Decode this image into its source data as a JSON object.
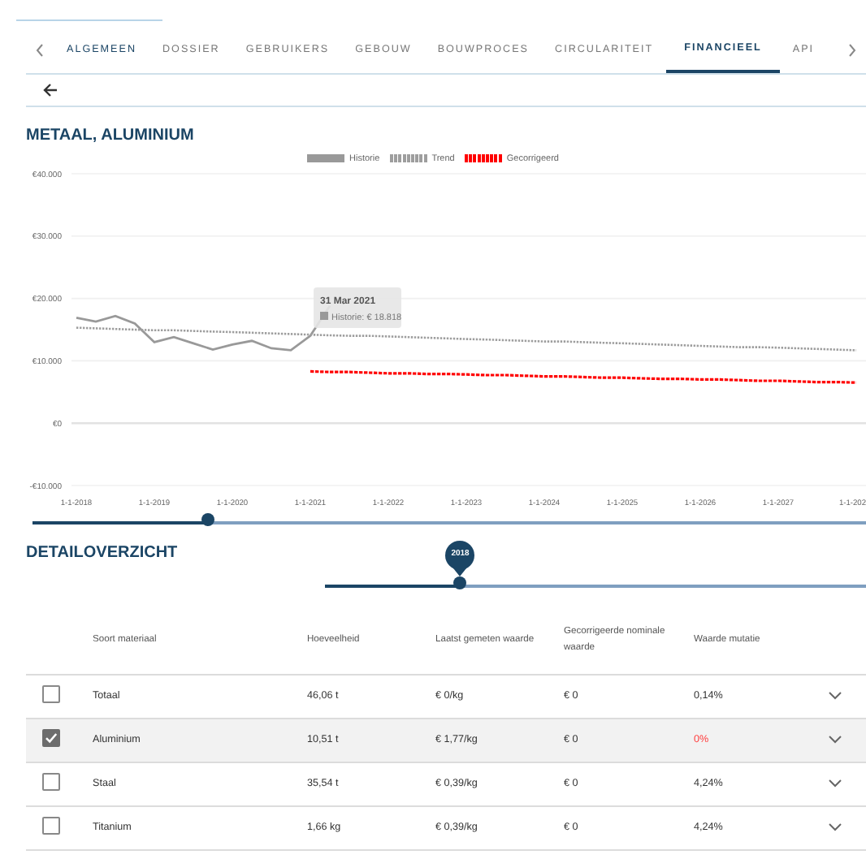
{
  "tabs": [
    {
      "label": "ALGEMEEN",
      "selected": false,
      "hovered": true
    },
    {
      "label": "DOSSIER",
      "selected": false,
      "hovered": false
    },
    {
      "label": "GEBRUIKERS",
      "selected": false,
      "hovered": false
    },
    {
      "label": "GEBOUW",
      "selected": false,
      "hovered": false
    },
    {
      "label": "BOUWPROCES",
      "selected": false,
      "hovered": false
    },
    {
      "label": "CIRCULARITEIT",
      "selected": false,
      "hovered": false
    },
    {
      "label": "FINANCIEEL",
      "selected": true,
      "hovered": false
    },
    {
      "label": "API",
      "selected": false,
      "hovered": false
    }
  ],
  "title": "METAAL, ALUMINIUM",
  "chart": {
    "chart_data": {
      "type": "line",
      "categories": [
        "1-1-2018",
        null,
        null,
        null,
        "1-1-2019",
        null,
        null,
        null,
        "1-1-2020",
        null,
        null,
        null,
        "1-1-2021",
        null,
        null,
        null,
        "1-1-2022",
        null,
        null,
        null,
        "1-1-2023",
        null,
        null,
        null,
        "1-1-2024",
        null,
        null,
        null,
        "1-1-2025",
        null,
        null,
        null,
        "1-1-2026",
        null,
        null,
        null,
        "1-1-2027",
        null,
        null,
        null,
        "1-1-202"
      ],
      "series": [
        {
          "name": "Historie",
          "color": "#999999",
          "line_style": "solid",
          "values": [
            16900,
            16300,
            17200,
            16000,
            13000,
            13800,
            12800,
            11800,
            12600,
            13200,
            12000,
            11700,
            14000,
            18800,
            null,
            null,
            null,
            null,
            null,
            null,
            null,
            null,
            null,
            null,
            null,
            null,
            null,
            null,
            null,
            null,
            null,
            null,
            null,
            null,
            null,
            null,
            null,
            null,
            null,
            null,
            null
          ]
        },
        {
          "name": "Trend",
          "color": "#9e9e9e",
          "line_style": "dotted",
          "values": [
            15300,
            15200,
            15100,
            15000,
            14900,
            14900,
            14800,
            14700,
            14600,
            14500,
            14400,
            14300,
            14200,
            14100,
            14000,
            14000,
            13900,
            13800,
            13700,
            13600,
            13500,
            13400,
            13300,
            13200,
            13100,
            13100,
            13000,
            12900,
            12800,
            12700,
            12600,
            12500,
            12400,
            12300,
            12200,
            12200,
            12100,
            12000,
            11900,
            11800,
            11700
          ]
        },
        {
          "name": "Gecorrigeerd",
          "color": "#ff0000",
          "line_style": "dashed",
          "values": [
            null,
            null,
            null,
            null,
            null,
            null,
            null,
            null,
            null,
            null,
            null,
            null,
            8300,
            8200,
            8200,
            8100,
            8000,
            8000,
            7900,
            7900,
            7800,
            7700,
            7700,
            7600,
            7500,
            7500,
            7400,
            7300,
            7300,
            7200,
            7100,
            7100,
            7000,
            7000,
            6900,
            6800,
            6800,
            6700,
            6600,
            6600,
            6500
          ]
        }
      ],
      "ylim": [
        -10000,
        40000
      ],
      "grid": true,
      "legend": "top",
      "yticks": [
        {
          "value": 40000,
          "label": "€40.000"
        },
        {
          "value": 30000,
          "label": "€30.000"
        },
        {
          "value": 20000,
          "label": "€20.000"
        },
        {
          "value": 10000,
          "label": "€10.000"
        },
        {
          "value": 0,
          "label": "€0"
        },
        {
          "value": -10000,
          "label": "-€10.000"
        }
      ]
    },
    "tooltip": {
      "title": "31 Mar 2021",
      "text": "Historie: € 18.818"
    }
  },
  "range_slider": {
    "level": 0.21
  },
  "section_title": "DETAILOVERZICHT",
  "year_slider": {
    "level": 0.25,
    "value_label": "2018"
  },
  "table": {
    "columns": [
      "Soort materiaal",
      "Hoeveelheid",
      "Laatst gemeten waarde",
      "Gecorrigeerde nominale waarde",
      "Waarde mutatie"
    ],
    "rows": [
      {
        "checked": false,
        "cells": [
          "Totaal",
          "46,06 t",
          "€ 0/kg",
          "€ 0",
          "0,14%"
        ],
        "mutation_negative": false
      },
      {
        "checked": true,
        "cells": [
          "Aluminium",
          "10,51 t",
          "€ 1,77/kg",
          "€ 0",
          "0%"
        ],
        "mutation_negative": true
      },
      {
        "checked": false,
        "cells": [
          "Staal",
          "35,54 t",
          "€ 0,39/kg",
          "€ 0",
          "4,24%"
        ],
        "mutation_negative": false
      },
      {
        "checked": false,
        "cells": [
          "Titanium",
          "1,66 kg",
          "€ 0,39/kg",
          "€ 0",
          "4,24%"
        ],
        "mutation_negative": false
      }
    ]
  }
}
